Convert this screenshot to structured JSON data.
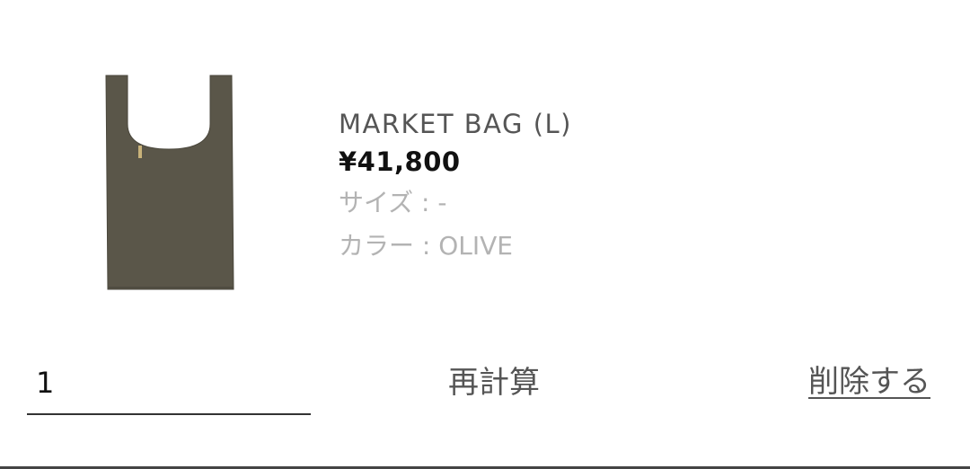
{
  "cart_item": {
    "name": "MARKET BAG (L)",
    "price": "¥41,800",
    "size_label": "サイズ : -",
    "color_label": "カラー : OLIVE",
    "image_color": "#5a5649"
  },
  "actions": {
    "quantity_value": "1",
    "recalculate_label": "再計算",
    "delete_label": "削除する"
  }
}
